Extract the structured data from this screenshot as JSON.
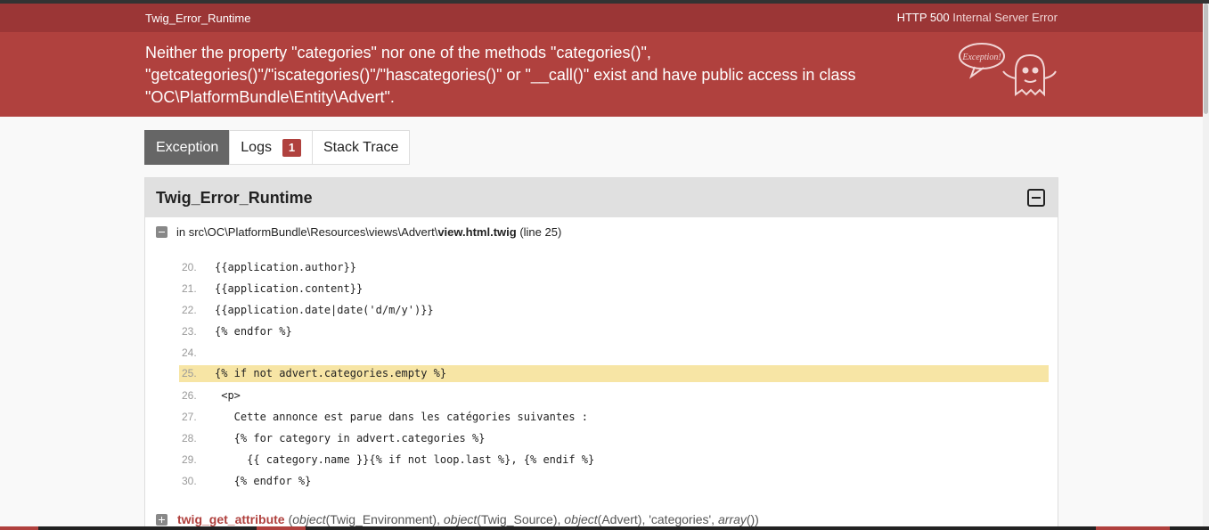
{
  "header": {
    "exception_class": "Twig_Error_Runtime",
    "status_code": "HTTP 500",
    "status_text": "Internal Server Error"
  },
  "error": {
    "message_line1": "Neither the property \"categories\" nor one of the methods \"categories()\",",
    "message_line2": "\"getcategories()\"/\"iscategories()\"/\"hascategories()\" or \"__call()\" exist and have public access in class",
    "message_line3": "\"OC\\PlatformBundle\\Entity\\Advert\".",
    "ghost_label": "Exception!"
  },
  "tabs": [
    {
      "label": "Exception",
      "active": true
    },
    {
      "label": "Logs",
      "badge": "1"
    },
    {
      "label": "Stack Trace"
    }
  ],
  "panel": {
    "title": "Twig_Error_Runtime",
    "trace_prefix": "in src\\OC\\PlatformBundle\\Resources\\views\\Advert\\",
    "trace_file": "view.html.twig",
    "trace_line": "(line 25)"
  },
  "code_lines": [
    {
      "num": "20.",
      "text": "{{application.author}}"
    },
    {
      "num": "21.",
      "text": "{{application.content}}"
    },
    {
      "num": "22.",
      "text": "{{application.date|date('d/m/y')}}"
    },
    {
      "num": "23.",
      "text": "{% endfor %}"
    },
    {
      "num": "24.",
      "text": ""
    },
    {
      "num": "25.",
      "text": "{% if not advert.categories.empty %}",
      "highlight": true
    },
    {
      "num": "26.",
      "text": " <p>"
    },
    {
      "num": "27.",
      "text": "   Cette annonce est parue dans les catégories suivantes :"
    },
    {
      "num": "28.",
      "text": "   {% for category in advert.categories %}"
    },
    {
      "num": "29.",
      "text": "     {{ category.name }}{% if not loop.last %}, {% endif %}"
    },
    {
      "num": "30.",
      "text": "   {% endfor %}"
    }
  ],
  "call": {
    "function": "twig_get_attribute",
    "open": "(",
    "arg1_type": "object",
    "arg1_val": "(Twig_Environment), ",
    "arg2_type": "object",
    "arg2_val": "(Twig_Source), ",
    "arg3_type": "object",
    "arg3_val": "(Advert), 'categories', ",
    "arg4_type": "array",
    "arg4_val": "())"
  },
  "colors": {
    "header_bg": "#9b3636",
    "banner_bg": "#b0413e",
    "highlight_bg": "#f7e5a5",
    "active_tab_bg": "#666666"
  }
}
